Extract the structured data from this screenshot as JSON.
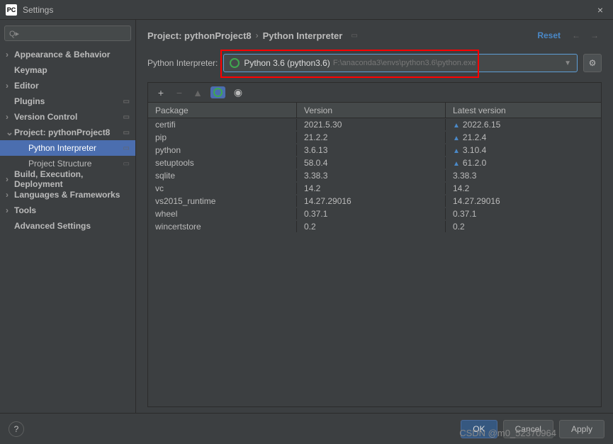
{
  "window": {
    "title": "Settings",
    "logo": "PC",
    "close": "×"
  },
  "search": {
    "placeholder": "Q▸"
  },
  "tree": [
    {
      "label": "Appearance & Behavior",
      "type": "collapsed",
      "bold": true
    },
    {
      "label": "Keymap",
      "type": "no-arrow",
      "bold": true
    },
    {
      "label": "Editor",
      "type": "collapsed",
      "bold": true
    },
    {
      "label": "Plugins",
      "type": "no-arrow",
      "bold": true,
      "proj": true
    },
    {
      "label": "Version Control",
      "type": "collapsed",
      "bold": true,
      "proj": true
    },
    {
      "label": "Project: pythonProject8",
      "type": "expanded",
      "bold": true,
      "proj": true
    },
    {
      "label": "Python Interpreter",
      "type": "sub",
      "selected": true,
      "proj": true
    },
    {
      "label": "Project Structure",
      "type": "sub",
      "proj": true
    },
    {
      "label": "Build, Execution, Deployment",
      "type": "collapsed",
      "bold": true
    },
    {
      "label": "Languages & Frameworks",
      "type": "collapsed",
      "bold": true
    },
    {
      "label": "Tools",
      "type": "collapsed",
      "bold": true
    },
    {
      "label": "Advanced Settings",
      "type": "no-arrow",
      "bold": true
    }
  ],
  "breadcrumb": {
    "a": "Project: pythonProject8",
    "sep": "›",
    "b": "Python Interpreter",
    "reset": "Reset",
    "left": "←",
    "right": "→"
  },
  "interpreter": {
    "label": "Python Interpreter:",
    "name": "Python 3.6 (python3.6)",
    "path": "F:\\anaconda3\\envs\\python3.6\\python.exe",
    "arrow": "▼"
  },
  "toolbar": {
    "add": "+",
    "remove": "−",
    "up": "▲",
    "eye": "◉"
  },
  "columns": {
    "c1": "Package",
    "c2": "Version",
    "c3": "Latest version"
  },
  "packages": [
    {
      "name": "certifi",
      "ver": "2021.5.30",
      "latest": "2022.6.15",
      "up": true
    },
    {
      "name": "pip",
      "ver": "21.2.2",
      "latest": "21.2.4",
      "up": true
    },
    {
      "name": "python",
      "ver": "3.6.13",
      "latest": "3.10.4",
      "up": true
    },
    {
      "name": "setuptools",
      "ver": "58.0.4",
      "latest": "61.2.0",
      "up": true
    },
    {
      "name": "sqlite",
      "ver": "3.38.3",
      "latest": "3.38.3",
      "up": false
    },
    {
      "name": "vc",
      "ver": "14.2",
      "latest": "14.2",
      "up": false
    },
    {
      "name": "vs2015_runtime",
      "ver": "14.27.29016",
      "latest": "14.27.29016",
      "up": false
    },
    {
      "name": "wheel",
      "ver": "0.37.1",
      "latest": "0.37.1",
      "up": false
    },
    {
      "name": "wincertstore",
      "ver": "0.2",
      "latest": "0.2",
      "up": false
    }
  ],
  "buttons": {
    "ok": "OK",
    "cancel": "Cancel",
    "apply": "Apply",
    "help": "?"
  },
  "watermark": "CSDN @m0_52370964"
}
